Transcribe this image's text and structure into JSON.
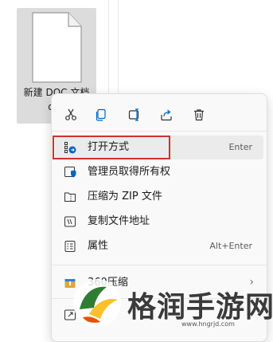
{
  "file": {
    "name_line1": "新建 DOC 文档",
    "name_line2": "doc"
  },
  "toolbar": {
    "icons": [
      "cut-icon",
      "copy-icon",
      "rename-icon",
      "share-icon",
      "delete-icon"
    ]
  },
  "menu": {
    "items": [
      {
        "label": "打开方式",
        "shortcut": "Enter",
        "icon": "open-with-icon"
      },
      {
        "label": "管理员取得所有权",
        "shortcut": "",
        "icon": "shield-icon"
      },
      {
        "label": "压缩为 ZIP 文件",
        "shortcut": "",
        "icon": "zip-folder-icon"
      },
      {
        "label": "复制文件地址",
        "shortcut": "",
        "icon": "copy-path-icon"
      },
      {
        "label": "属性",
        "shortcut": "Alt+Enter",
        "icon": "properties-icon"
      },
      {
        "label": "360压缩",
        "shortcut": "",
        "icon": "archive-icon"
      }
    ]
  },
  "watermark": {
    "text": "格润手游网",
    "url": "www.hngrjd.com"
  },
  "colors": {
    "highlight": "#d32f2f",
    "accent": "#0067c0",
    "menu_bg": "#f9f9f9"
  }
}
